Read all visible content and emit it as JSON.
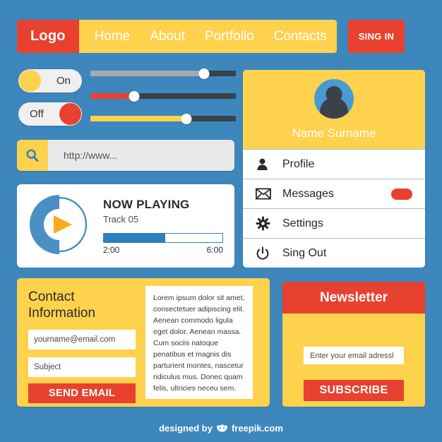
{
  "colors": {
    "background": "#3d87bd",
    "yellow": "#ffd24d",
    "red": "#e8412f",
    "blue": "#2e7fbd",
    "dark": "#3b4049",
    "white": "#ffffff"
  },
  "navbar": {
    "logo": "Logo",
    "links": [
      "Home",
      "About",
      "Portfolio",
      "Contacts"
    ],
    "signin_label": "SING IN"
  },
  "toggles": [
    {
      "label": "On",
      "state": "on",
      "knob_color": "#ffd24d"
    },
    {
      "label": "Off",
      "state": "off",
      "knob_color": "#e8412f"
    }
  ],
  "sliders": [
    {
      "name": "slider-gray",
      "value": 78,
      "fill_color": "#a8aaad"
    },
    {
      "name": "slider-red",
      "value": 30,
      "fill_color": "#e8412f"
    },
    {
      "name": "slider-yellow",
      "value": 66,
      "fill_color": "#ffd24d"
    }
  ],
  "search": {
    "icon": "search-icon",
    "placeholder": "http://www..."
  },
  "player": {
    "title": "NOW PLAYING",
    "track": "Track 05",
    "progress_percent": 52,
    "ring_percent": 50,
    "time_current": "2:00",
    "time_total": "6:00",
    "play_icon": "play-icon"
  },
  "profile": {
    "name": "Name Surname",
    "avatar_icon": "user-avatar-icon",
    "menu": [
      {
        "label": "Profile",
        "icon": "person-icon",
        "badge": false
      },
      {
        "label": "Messages",
        "icon": "envelope-icon",
        "badge": true
      },
      {
        "label": "Settings",
        "icon": "gear-icon",
        "badge": false
      },
      {
        "label": "Sing Out",
        "icon": "power-icon",
        "badge": false
      }
    ]
  },
  "contact": {
    "title": "Contact Information",
    "email_placeholder": "yourname@email.com",
    "subject_placeholder": "Subject",
    "send_label": "SEND EMAIL",
    "lorem": "Lorem ipsum dolor sit amet, consectetuer adipiscing elit. Aenean commodo ligula eget dolor. Aenean massa. Cum sociis natoque penatibus et magnis dis parturient montes, nascetur ridiculus mus. Donec quam felis, ultricies neceu sem."
  },
  "newsletter": {
    "title": "Newsletter",
    "email_placeholder": "Enter your email adressl",
    "subscribe_label": "SUBSCRIBE"
  },
  "footer": {
    "prefix": "designed by",
    "brand": "freepik.com",
    "logo_icon": "freepik-crown-icon"
  }
}
